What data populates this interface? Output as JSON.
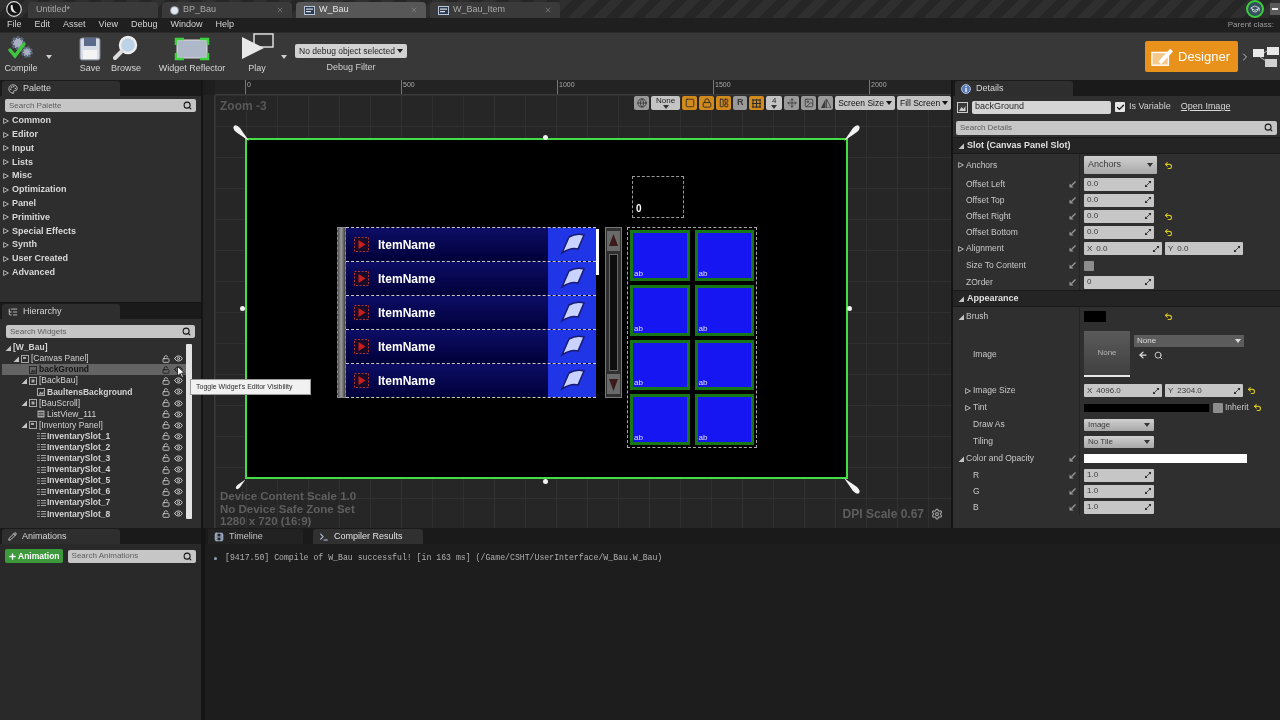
{
  "editor_tabs": [
    {
      "label": "Untitled*",
      "kind": "level",
      "closable": false,
      "selected": false
    },
    {
      "label": "BP_Bau",
      "kind": "blueprint",
      "closable": true,
      "selected": false
    },
    {
      "label": "W_Bau",
      "kind": "widget",
      "closable": true,
      "selected": true
    },
    {
      "label": "W_Bau_Item",
      "kind": "widget",
      "closable": true,
      "selected": false
    }
  ],
  "menu": [
    "File",
    "Edit",
    "Asset",
    "View",
    "Debug",
    "Window",
    "Help"
  ],
  "parent_class": "Parent class:",
  "toolbar": {
    "buttons": [
      {
        "label": "Compile",
        "kind": "compile",
        "dropdown": true
      },
      {
        "label": "Save",
        "kind": "save",
        "dropdown": false
      },
      {
        "label": "Browse",
        "kind": "browse",
        "dropdown": false
      },
      {
        "label": "Widget Reflector",
        "kind": "reflector",
        "dropdown": false
      },
      {
        "label": "Play",
        "kind": "play",
        "dropdown": true
      }
    ],
    "debug_select": "No debug object selected",
    "debug_label": "Debug Filter",
    "mode": {
      "label": "Designer",
      "selected": true
    }
  },
  "palette": {
    "title": "Palette",
    "placeholder": "Search Palette",
    "categories": [
      {
        "label": "Common",
        "expanded": false
      },
      {
        "label": "Editor",
        "expanded": false
      },
      {
        "label": "Input",
        "expanded": false
      },
      {
        "label": "Lists",
        "expanded": false
      },
      {
        "label": "Misc",
        "expanded": false
      },
      {
        "label": "Optimization",
        "expanded": false
      },
      {
        "label": "Panel",
        "expanded": false
      },
      {
        "label": "Primitive",
        "expanded": false
      },
      {
        "label": "Special Effects",
        "expanded": false
      },
      {
        "label": "Synth",
        "expanded": false
      },
      {
        "label": "User Created",
        "expanded": false
      },
      {
        "label": "Advanced",
        "expanded": false
      }
    ]
  },
  "hierarchy": {
    "title": "Hierarchy",
    "placeholder": "Search Widgets",
    "tree": [
      {
        "label": "[W_Bau]",
        "is_variable": true,
        "selected": false,
        "expanded": true,
        "children": [
          {
            "label": "[Canvas Panel]",
            "kind": "canvas",
            "is_variable": false,
            "selected": false,
            "locked": false,
            "visible": true,
            "expanded": true,
            "children": [
              {
                "label": "backGround",
                "kind": "image",
                "is_variable": true,
                "selected": true,
                "locked": false,
                "visible": true
              },
              {
                "label": "[BackBau]",
                "kind": "border",
                "is_variable": false,
                "selected": false,
                "locked": false,
                "visible": true,
                "expanded": true,
                "children": [
                  {
                    "label": "BaultensBackground",
                    "kind": "image",
                    "is_variable": true,
                    "selected": false,
                    "locked": false,
                    "visible": true
                  }
                ]
              },
              {
                "label": "[BauScroll]",
                "kind": "border",
                "is_variable": false,
                "selected": false,
                "locked": false,
                "visible": true,
                "expanded": true,
                "children": [
                  {
                    "label": "ListView_111",
                    "kind": "list",
                    "is_variable": false,
                    "selected": false,
                    "locked": false,
                    "visible": true
                  }
                ]
              },
              {
                "label": "[Inventory Panel]",
                "kind": "canvas",
                "is_variable": false,
                "selected": false,
                "locked": false,
                "visible": true,
                "expanded": true,
                "children": [
                  {
                    "label": "InventarySlot_1",
                    "kind": "user",
                    "is_variable": true,
                    "selected": false,
                    "locked": false,
                    "visible": true
                  },
                  {
                    "label": "InventarySlot_2",
                    "kind": "user",
                    "is_variable": true,
                    "selected": false,
                    "locked": false,
                    "visible": true
                  },
                  {
                    "label": "InventarySlot_3",
                    "kind": "user",
                    "is_variable": true,
                    "selected": false,
                    "locked": false,
                    "visible": true
                  },
                  {
                    "label": "InventarySlot_4",
                    "kind": "user",
                    "is_variable": true,
                    "selected": false,
                    "locked": false,
                    "visible": true
                  },
                  {
                    "label": "InventarySlot_5",
                    "kind": "user",
                    "is_variable": true,
                    "selected": false,
                    "locked": false,
                    "visible": true
                  },
                  {
                    "label": "InventarySlot_6",
                    "kind": "user",
                    "is_variable": true,
                    "selected": false,
                    "locked": false,
                    "visible": true
                  },
                  {
                    "label": "InventarySlot_7",
                    "kind": "user",
                    "is_variable": true,
                    "selected": false,
                    "locked": false,
                    "visible": true
                  },
                  {
                    "label": "InventarySlot_8",
                    "kind": "user",
                    "is_variable": true,
                    "selected": false,
                    "locked": false,
                    "visible": true
                  }
                ]
              }
            ]
          }
        ]
      }
    ],
    "tooltip": "Toggle Widget's Editor Visibility"
  },
  "designer": {
    "ruler": [
      "0",
      "500",
      "1000",
      "1500",
      "2000"
    ],
    "zoom": "Zoom -3",
    "tools": [
      {
        "kind": "globe",
        "on": false
      },
      {
        "kind": "menu",
        "label": "None"
      },
      {
        "kind": "outline",
        "on": true
      },
      {
        "kind": "lock",
        "on": true
      },
      {
        "kind": "layout",
        "on": true
      },
      {
        "kind": "text",
        "label": "R",
        "on": false
      },
      {
        "kind": "grid",
        "on": true
      },
      {
        "kind": "menu",
        "label": "4"
      },
      {
        "kind": "move",
        "on": false
      },
      {
        "kind": "image",
        "on": false
      },
      {
        "kind": "mirror",
        "on": false
      },
      {
        "kind": "dropdown",
        "label": "Screen Size"
      },
      {
        "kind": "dropdown",
        "label": "Fill Screen"
      }
    ],
    "preview": {
      "list_rows": [
        {
          "label": "ItemName"
        },
        {
          "label": "ItemName"
        },
        {
          "label": "ItemName"
        },
        {
          "label": "ItemName"
        },
        {
          "label": "ItemName"
        }
      ],
      "counter": "0",
      "slots": [
        {
          "label": "ab"
        },
        {
          "label": "ab"
        },
        {
          "label": "ab"
        },
        {
          "label": "ab"
        },
        {
          "label": "ab"
        },
        {
          "label": "ab"
        },
        {
          "label": "ab"
        },
        {
          "label": "ab"
        }
      ]
    },
    "info": [
      "Device Content Scale 1.0",
      "No Device Safe Zone Set",
      "1280 x 720 (16:9)"
    ],
    "dpi": "DPI Scale 0.67"
  },
  "details": {
    "title": "Details",
    "name": "backGround",
    "is_variable": {
      "label": "Is Variable",
      "checked": true
    },
    "open_link": "Open Image",
    "placeholder": "Search Details",
    "sections": [
      {
        "title": "Slot (Canvas Panel Slot)",
        "expanded": true,
        "rows": [
          {
            "label": "Anchors",
            "kind": "combo",
            "value": "Anchors",
            "expanded": false,
            "pin": false,
            "reset": true
          },
          {
            "label": "Offset Left",
            "kind": "number",
            "value": "0.0",
            "pin": true,
            "reset": false
          },
          {
            "label": "Offset Top",
            "kind": "number",
            "value": "0.0",
            "pin": true,
            "reset": false
          },
          {
            "label": "Offset Right",
            "kind": "number",
            "value": "0.0",
            "pin": true,
            "reset": true
          },
          {
            "label": "Offset Bottom",
            "kind": "number",
            "value": "0.0",
            "pin": true,
            "reset": true
          },
          {
            "label": "Alignment",
            "kind": "vector",
            "values": [
              {
                "axis": "X",
                "value": "0.0"
              },
              {
                "axis": "Y",
                "value": "0.0"
              }
            ],
            "expanded": false,
            "pin": true,
            "reset": false
          },
          {
            "label": "Size To Content",
            "kind": "checkbox",
            "checked": false,
            "pin": true,
            "reset": false
          },
          {
            "label": "ZOrder",
            "kind": "number",
            "value": "0",
            "pin": true,
            "reset": false
          }
        ]
      },
      {
        "title": "Appearance",
        "expanded": true,
        "rows": [
          {
            "label": "Brush",
            "kind": "swatch",
            "color": "#000000",
            "expanded": true,
            "pin": false,
            "reset": true,
            "children": [
              {
                "label": "Image",
                "kind": "image",
                "thumbnail": "None",
                "value": "None",
                "pin": false,
                "reset": false
              },
              {
                "label": "Image Size",
                "kind": "vector",
                "values": [
                  {
                    "axis": "X",
                    "value": "4096.0"
                  },
                  {
                    "axis": "Y",
                    "value": "2304.0"
                  }
                ],
                "expanded": false,
                "pin": false,
                "reset": true
              },
              {
                "label": "Tint",
                "kind": "color_bar",
                "color": "#000000",
                "inherit": {
                  "label": "Inherit",
                  "checked": false
                },
                "expanded": false,
                "pin": false,
                "reset": true
              },
              {
                "label": "Draw As",
                "kind": "dropdown",
                "value": "Image",
                "pin": false,
                "reset": false
              },
              {
                "label": "Tiling",
                "kind": "dropdown",
                "value": "No Tile",
                "pin": false,
                "reset": false
              }
            ]
          },
          {
            "label": "Color and Opacity",
            "kind": "color_bar",
            "color": "#ffffff",
            "expanded": true,
            "pin": true,
            "reset": false,
            "children": [
              {
                "label": "R",
                "kind": "number",
                "value": "1.0",
                "pin": true,
                "reset": false
              },
              {
                "label": "G",
                "kind": "number",
                "value": "1.0",
                "pin": true,
                "reset": false
              },
              {
                "label": "B",
                "kind": "number",
                "value": "1.0",
                "pin": true,
                "reset": false
              }
            ]
          }
        ]
      }
    ]
  },
  "animations": {
    "title": "Animations",
    "add_button": "Animation",
    "placeholder": "Search Animations"
  },
  "output": {
    "tabs": [
      {
        "label": "Timeline",
        "kind": "timeline",
        "selected": false
      },
      {
        "label": "Compiler Results",
        "kind": "compiler",
        "selected": true
      }
    ],
    "log": [
      "[9417.50] Compile of W_Bau successful! [in 163 ms] (/Game/CSHT/UserInterface/W_Bau.W_Bau)"
    ]
  }
}
